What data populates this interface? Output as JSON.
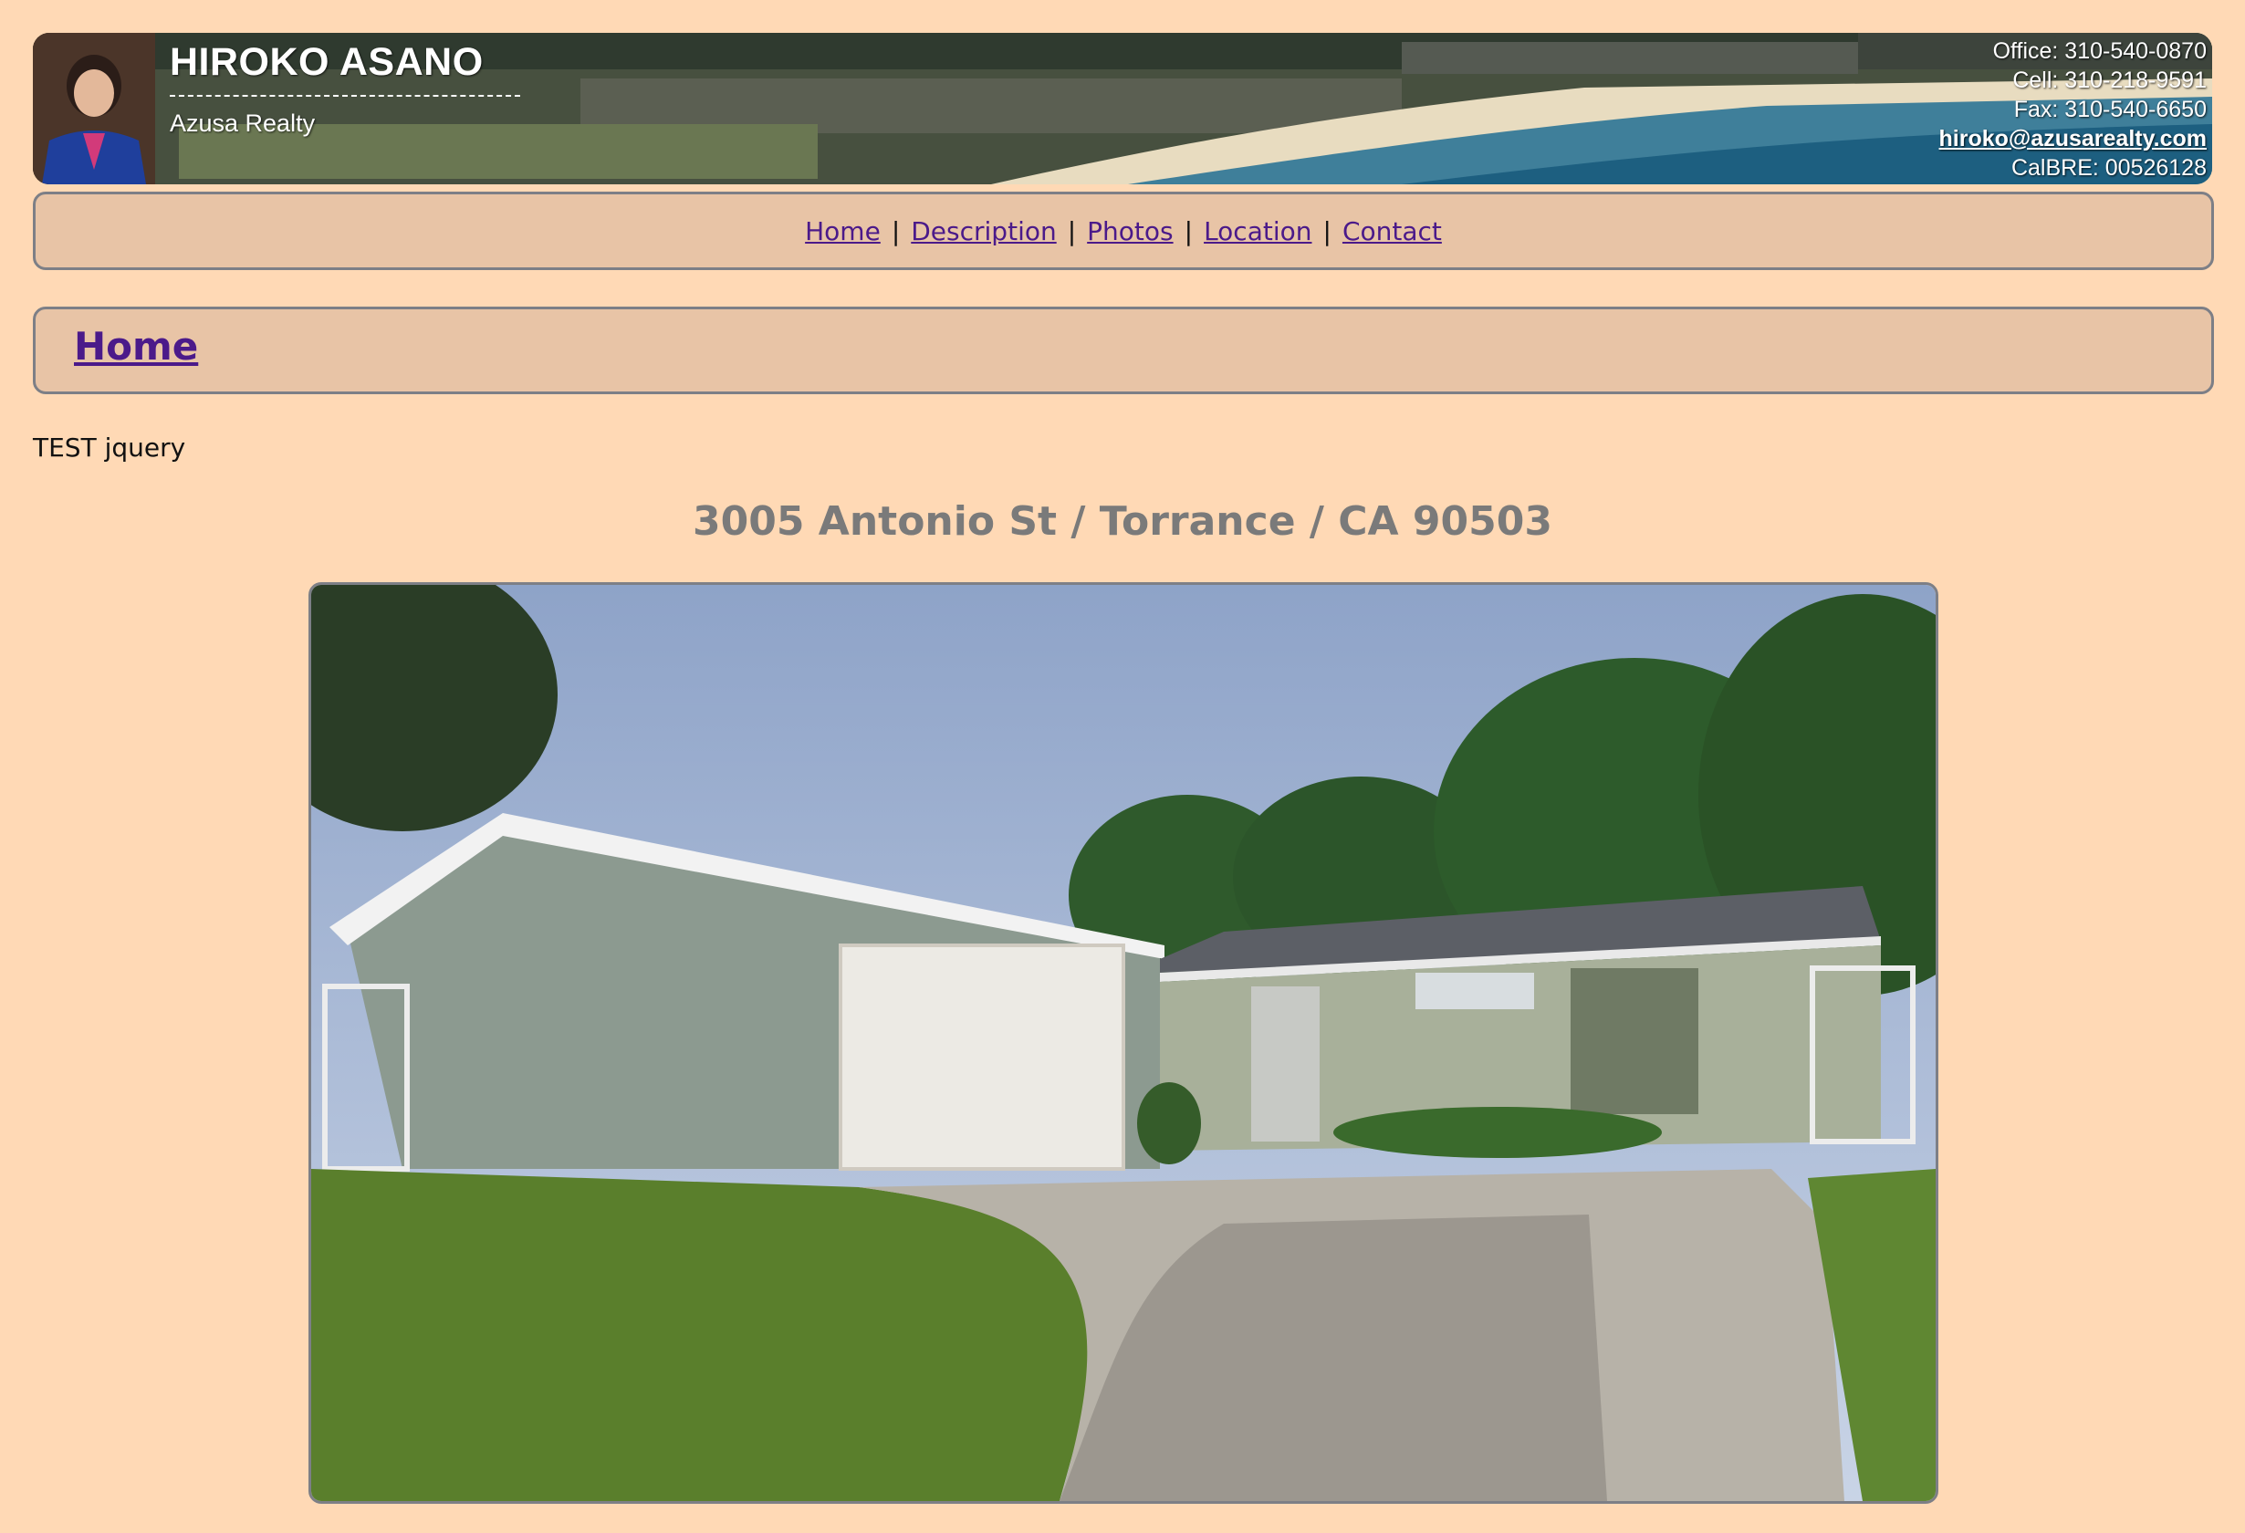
{
  "header": {
    "agent_name": "HIROKO ASANO",
    "company": "Azusa Realty",
    "office": "Office: 310-540-0870",
    "cell": "Cell: 310-218-9591",
    "fax": "Fax: 310-540-6650",
    "email": "hiroko@azusarealty.com",
    "license": "CalBRE: 00526128"
  },
  "nav": {
    "items": [
      "Home",
      "Description",
      "Photos",
      "Location",
      "Contact"
    ],
    "separator": "|"
  },
  "page": {
    "heading": "Home",
    "test_text": "TEST jquery",
    "address": "3005 Antonio St / Torrance / CA 90503"
  },
  "colors": {
    "page_background": "#FFD9B5",
    "box_background": "#E8C4A6",
    "link": "#4b1a8a",
    "address_text": "#7a7a7a"
  }
}
